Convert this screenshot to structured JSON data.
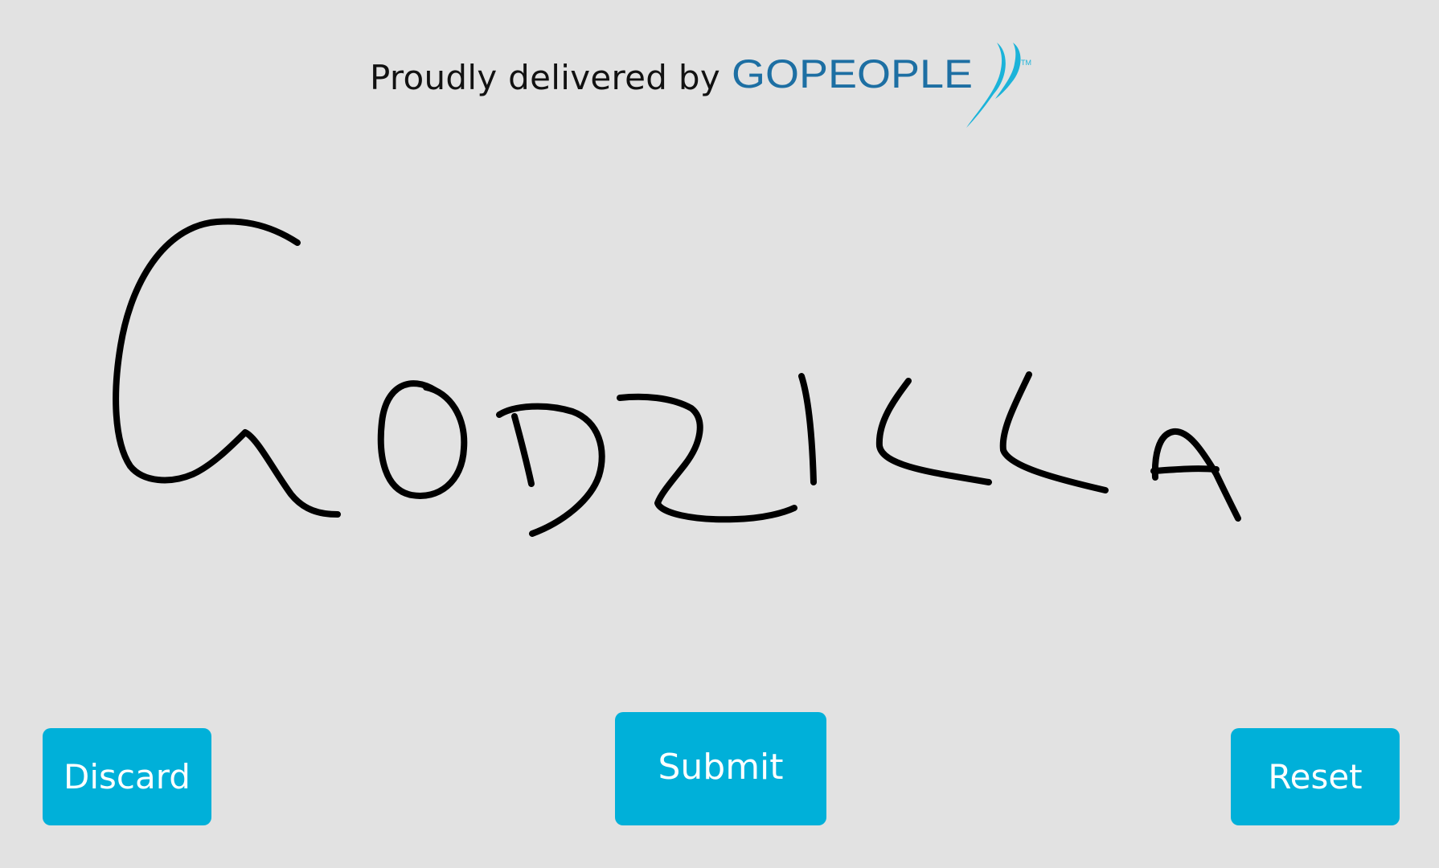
{
  "header": {
    "text": "Proudly delivered by",
    "logo_text": "GOPEOPLE",
    "logo_tm": "TM",
    "logo_icon": "swoosh-icon",
    "logo_colors": {
      "go": "#1bb3d9",
      "people": "#1d6fa3",
      "swoosh": "#1bb3d9"
    }
  },
  "signature": {
    "content": "GODZILLA",
    "ink_color": "#000000"
  },
  "buttons": {
    "discard": "Discard",
    "submit": "Submit",
    "reset": "Reset"
  },
  "colors": {
    "background": "#e2e2e2",
    "button": "#00b0d9",
    "button_text": "#ffffff"
  }
}
